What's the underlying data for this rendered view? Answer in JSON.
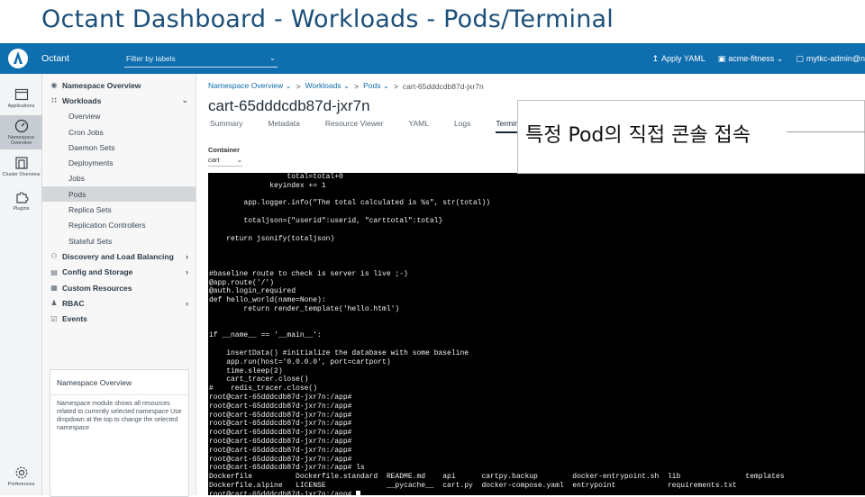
{
  "slide": {
    "title": "Octant Dashboard - Workloads - Pods/Terminal"
  },
  "topbar": {
    "app_name": "Octant",
    "filter_placeholder": "Filter by labels",
    "apply_yaml": "Apply YAML",
    "namespace": "acme-fitness",
    "context": "mytkc-admin@n"
  },
  "rail": {
    "items": [
      {
        "label": "Applications",
        "icon": "applications-icon"
      },
      {
        "label": "Namespace Overview",
        "icon": "dashboard-icon"
      },
      {
        "label": "Cluster Overview",
        "icon": "cluster-icon"
      },
      {
        "label": "Plugins",
        "icon": "puzzle-icon"
      }
    ],
    "preferences": "Preferences"
  },
  "nav": {
    "namespace_overview": "Namespace Overview",
    "workloads": "Workloads",
    "workload_items": [
      "Overview",
      "Cron Jobs",
      "Daemon Sets",
      "Deployments",
      "Jobs",
      "Pods",
      "Replica Sets",
      "Replication Controllers",
      "Stateful Sets"
    ],
    "discovery": "Discovery and Load Balancing",
    "config": "Config and Storage",
    "custom": "Custom Resources",
    "rbac": "RBAC",
    "events": "Events"
  },
  "ns_card": {
    "title": "Namespace Overview",
    "body": "Namespace module shows all resources related to currently selected namespace Use dropdown at the top to change the selected namespace"
  },
  "breadcrumb": {
    "items": [
      "Namespace Overview",
      "Workloads",
      "Pods"
    ],
    "current": "cart-65dddcdb87d-jxr7n"
  },
  "pod": {
    "title": "cart-65dddcdb87d-jxr7n"
  },
  "tabs": [
    "Summary",
    "Metadata",
    "Resource Viewer",
    "YAML",
    "Logs",
    "Terminal"
  ],
  "container": {
    "label": "Container",
    "value": "cart"
  },
  "terminal": {
    "lines": [
      "                  total=total+0",
      "              keyindex += 1",
      "",
      "        app.logger.info(\"The total calculated is %s\", str(total))",
      "",
      "        totaljson={\"userid\":userid, \"carttotal\":total}",
      "",
      "    return jsonify(totaljson)",
      "",
      "",
      "",
      "#baseline route to check is server is live ;-)",
      "@app.route('/')",
      "@auth.login_required",
      "def hello_world(name=None):",
      "        return render_template('hello.html')",
      "",
      "",
      "if __name__ == '__main__':",
      "",
      "    insertData() #initialize the database with some baseline",
      "    app.run(host='0.0.0.0', port=cartport)",
      "    time.sleep(2)",
      "    cart_tracer.close()",
      "#    redis_tracer.close()",
      "root@cart-65dddcdb87d-jxr7n:/app#",
      "root@cart-65dddcdb87d-jxr7n:/app#",
      "root@cart-65dddcdb87d-jxr7n:/app#",
      "root@cart-65dddcdb87d-jxr7n:/app#",
      "root@cart-65dddcdb87d-jxr7n:/app#",
      "root@cart-65dddcdb87d-jxr7n:/app#",
      "root@cart-65dddcdb87d-jxr7n:/app#",
      "root@cart-65dddcdb87d-jxr7n:/app#",
      "root@cart-65dddcdb87d-jxr7n:/app# ls",
      "Dockerfile          Dockerfile.standard  README.md    api      cartpy.backup        docker-entrypoint.sh  lib               templates",
      "Dockerfile.alpine   LICENSE              __pycache__  cart.py  docker-compose.yaml  entrypoint            requirements.txt",
      "root@cart-65dddcdb87d-jxr7n:/app# "
    ]
  },
  "callout": {
    "text": "특정 Pod의 직접 콘솔 접속"
  }
}
